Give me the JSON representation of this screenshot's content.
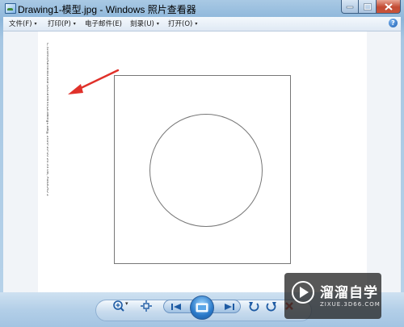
{
  "window": {
    "title": "Drawing1-模型.jpg - Windows 照片查看器"
  },
  "menu": {
    "items": [
      {
        "label": "文件(F)",
        "has_dropdown": true
      },
      {
        "label": "打印(P)",
        "has_dropdown": true
      },
      {
        "label": "电子邮件(E)",
        "has_dropdown": false
      },
      {
        "label": "刻录(U)",
        "has_dropdown": true
      },
      {
        "label": "打开(O)",
        "has_dropdown": true
      }
    ],
    "caret": "▾",
    "help": "?"
  },
  "image": {
    "vertical_caption": "C:\\Users\\Administrator\\Documents\\Drawing1.dwg, 2020-10-10 20:33:08, AutoCAD 2007 PDF",
    "shapes": [
      "drawing-frame",
      "circle"
    ],
    "annotation_arrow_color": "#e0312a"
  },
  "controls": {
    "icons": [
      "zoom-icon",
      "fit-window-icon",
      "previous-icon",
      "slideshow-icon",
      "next-icon",
      "rotate-counterclockwise-icon",
      "rotate-clockwise-icon",
      "delete-icon"
    ]
  },
  "watermark": {
    "title": "溜溜自学",
    "url": "ZIXUE.3D66.COM"
  },
  "colors": {
    "title_bar": "#a9c9e4",
    "close_button": "#c24a33",
    "accent": "#2a79c9"
  }
}
